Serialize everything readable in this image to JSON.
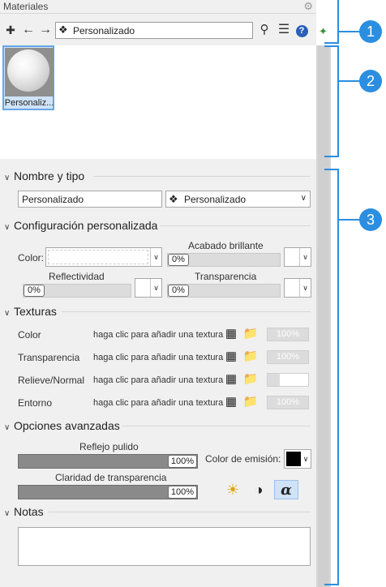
{
  "window": {
    "title": "Materiales"
  },
  "toolbar": {
    "material_name": "Personalizado"
  },
  "preview": {
    "thumb_label": "Personaliz..."
  },
  "sections": {
    "name_type": {
      "title": "Nombre y tipo",
      "name_value": "Personalizado",
      "type_value": "Personalizado"
    },
    "custom": {
      "title": "Configuración personalizada",
      "color_label": "Color:",
      "glossy_label": "Acabado brillante",
      "glossy_value": "0%",
      "reflectivity_label": "Reflectividad",
      "reflectivity_value": "0%",
      "transparency_label": "Transparencia",
      "transparency_value": "0%"
    },
    "textures": {
      "title": "Texturas",
      "rows": [
        {
          "name": "Color",
          "hint": "haga clic para añadir una textura",
          "amount": "100%"
        },
        {
          "name": "Transparencia",
          "hint": "haga clic para añadir una textura",
          "amount": "100%"
        },
        {
          "name": "Relieve/Normal",
          "hint": "haga clic para añadir una textura",
          "amount": "30%"
        },
        {
          "name": "Entorno",
          "hint": "haga clic para añadir una textura",
          "amount": "100%"
        }
      ]
    },
    "advanced": {
      "title": "Opciones avanzadas",
      "polish_label": "Reflejo pulido",
      "polish_value": "100%",
      "emission_label": "Color de emisión:",
      "clarity_label": "Claridad de transparencia",
      "clarity_value": "100%"
    },
    "notes": {
      "title": "Notas",
      "value": ""
    }
  },
  "callouts": [
    "1",
    "2",
    "3"
  ],
  "colors": {
    "accent": "#2b8ee0",
    "emission": "#000000"
  },
  "icons": [
    "new-material-icon",
    "back-arrow-icon",
    "forward-arrow-icon",
    "material-type-icon",
    "search-icon",
    "menu-icon",
    "help-icon",
    "plugin-icon",
    "grid-view-icon",
    "list-view-icon",
    "tree-view-icon",
    "checker-icon",
    "folder-icon",
    "lamp-icon",
    "contrast-icon",
    "alpha-icon",
    "gear-icon"
  ]
}
